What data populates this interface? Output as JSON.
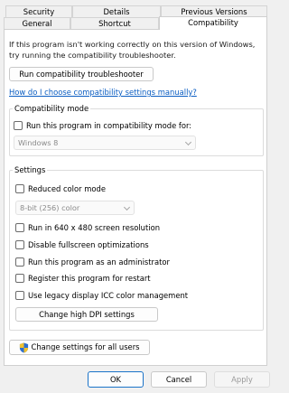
{
  "tabs": {
    "row1": [
      "Security",
      "Details",
      "Previous Versions"
    ],
    "row2": [
      "General",
      "Shortcut",
      "Compatibility"
    ],
    "active": "Compatibility"
  },
  "intro_text": "If this program isn't working correctly on this version of Windows, try running the compatibility troubleshooter.",
  "troubleshooter_button": "Run compatibility troubleshooter",
  "help_link": "How do I choose compatibility settings manually?",
  "compat_mode": {
    "legend": "Compatibility mode",
    "checkbox_label": "Run this program in compatibility mode for:",
    "checked": false,
    "select_value": "Windows 8"
  },
  "settings": {
    "legend": "Settings",
    "reduced_color_label": "Reduced color mode",
    "reduced_color_checked": false,
    "color_select_value": "8-bit (256) color",
    "options": [
      {
        "label": "Run in 640 x 480 screen resolution",
        "checked": false
      },
      {
        "label": "Disable fullscreen optimizations",
        "checked": false
      },
      {
        "label": "Run this program as an administrator",
        "checked": false
      },
      {
        "label": "Register this program for restart",
        "checked": false
      },
      {
        "label": "Use legacy display ICC color management",
        "checked": false
      }
    ],
    "dpi_button": "Change high DPI settings"
  },
  "all_users_button": "Change settings for all users",
  "all_users_icon": "uac-shield-icon",
  "footer": {
    "ok": "OK",
    "cancel": "Cancel",
    "apply": "Apply"
  },
  "colors": {
    "link": "#0a5dc2",
    "ok_border": "#1a73c8"
  }
}
